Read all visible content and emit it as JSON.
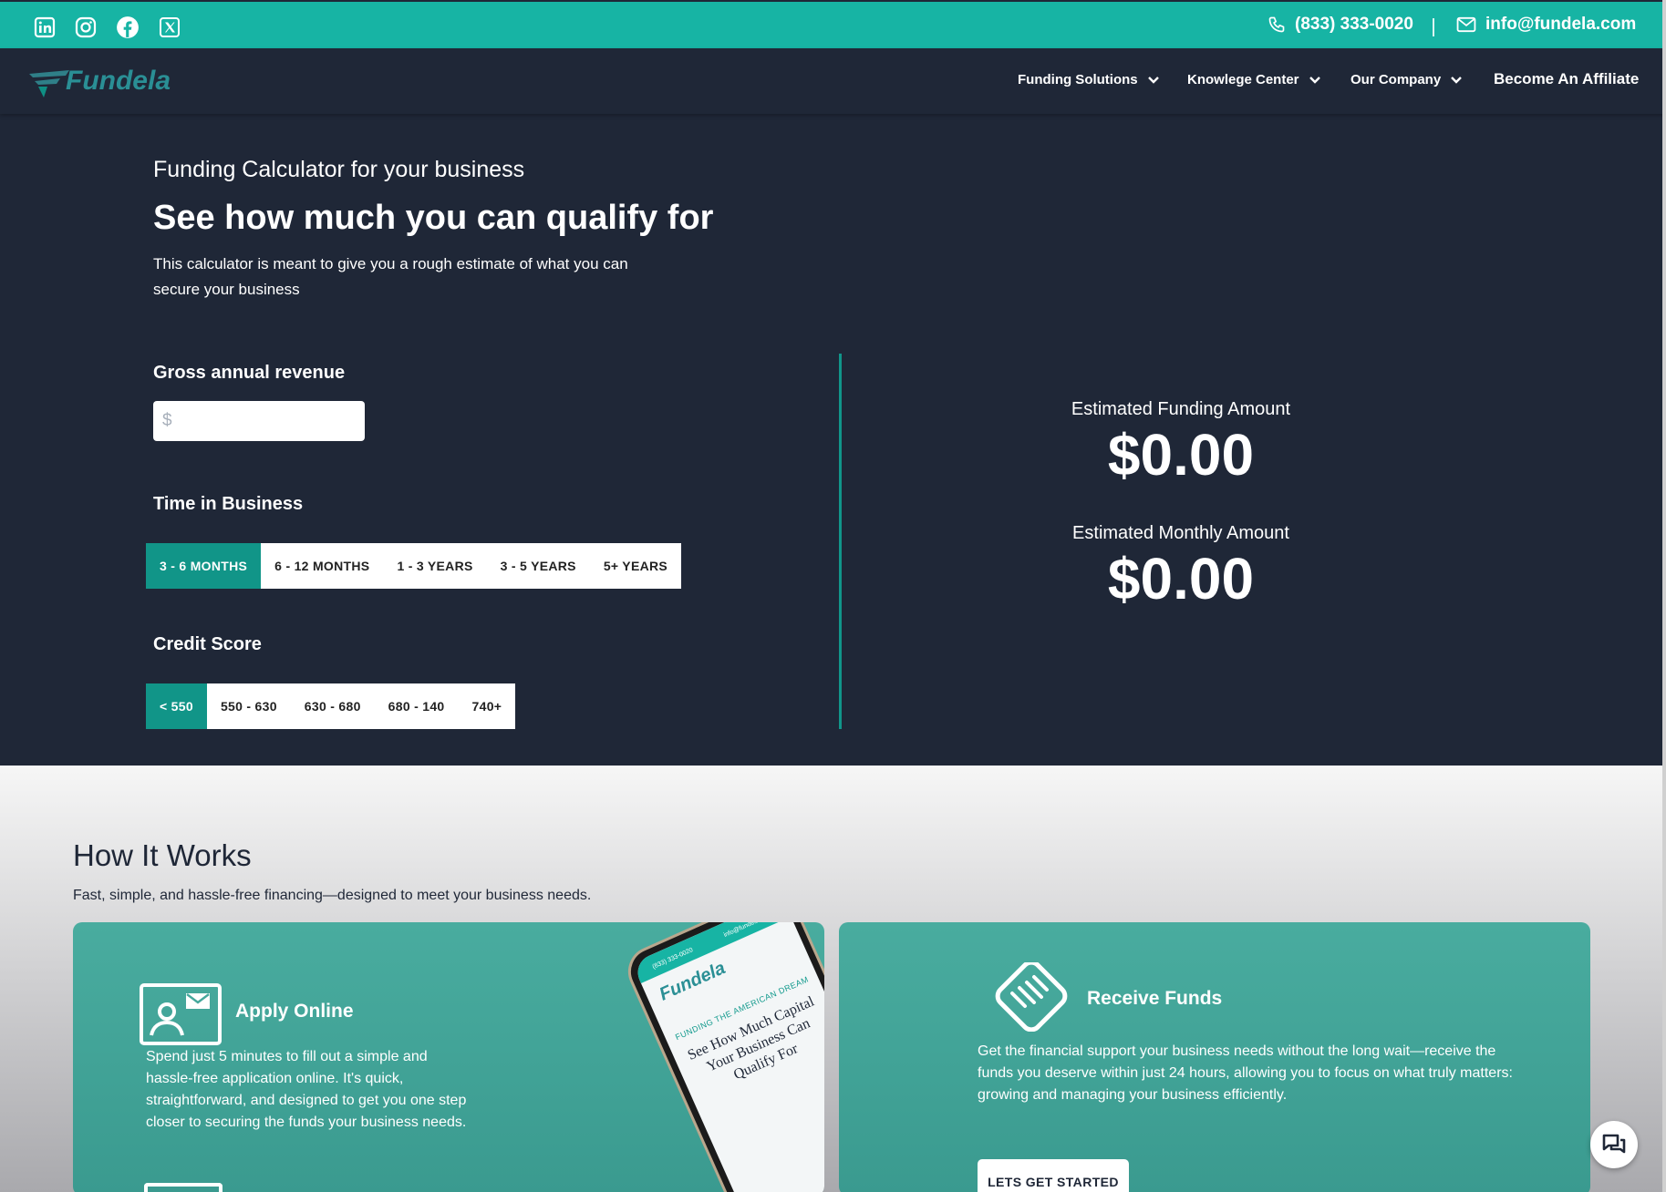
{
  "topbar": {
    "social": [
      "linkedin-icon",
      "instagram-icon",
      "facebook-icon",
      "x-twitter-icon"
    ],
    "phone": "(833) 333-0020",
    "email": "info@fundela.com"
  },
  "nav": {
    "logo_alt": "Fundela",
    "items": [
      {
        "label": "Funding Solutions"
      },
      {
        "label": "Knowlege Center"
      },
      {
        "label": "Our Company"
      },
      {
        "label": "Become An Affiliate"
      }
    ]
  },
  "hero": {
    "subtitle": "Funding Calculator for your business",
    "title": "See how much you can qualify for",
    "description": "This calculator is meant to give you a rough estimate of what you can secure your business"
  },
  "calculator": {
    "revenue_label": "Gross annual revenue",
    "revenue_placeholder": "$",
    "time_label": "Time in Business",
    "time_options": [
      "3 - 6 MONTHS",
      "6 - 12 MONTHS",
      "1 - 3 YEARS",
      "3 - 5 YEARS",
      "5+ YEARS"
    ],
    "time_selected": 0,
    "credit_label": "Credit Score",
    "credit_options": [
      "< 550",
      "550 - 630",
      "630 - 680",
      "680 - 140",
      "740+"
    ],
    "credit_selected": 0
  },
  "results": {
    "funding_label": "Estimated Funding Amount",
    "funding_value": "$0.00",
    "monthly_label": "Estimated Monthly Amount",
    "monthly_value": "$0.00"
  },
  "how": {
    "title": "How It Works",
    "description": "Fast, simple, and hassle-free financing—designed to meet your business needs.",
    "apply": {
      "title": "Apply Online",
      "text": "Spend just 5 minutes to fill out a simple and hassle-free application online. It's quick, straightforward, and designed to get you one step closer to securing the funds your business needs."
    },
    "phone_mockup": {
      "phone": "(833) 333-0020",
      "email": "info@fundela.com",
      "logo": "Fundela",
      "tagline": "FUNDING THE AMERICAN DREAM",
      "headline": "See How Much Capital Your Business Can Qualify For"
    },
    "receive": {
      "title": "Receive Funds",
      "text": "Get the financial support your business needs without the long wait—receive the funds you deserve within just 24 hours, allowing you to focus on what truly matters: growing and managing your business efficiently.",
      "cta": "LETS GET STARTED"
    }
  },
  "colors": {
    "teal": "#17b4a4",
    "navy": "#1f2737",
    "active": "#119588",
    "card": "#45a89c"
  }
}
